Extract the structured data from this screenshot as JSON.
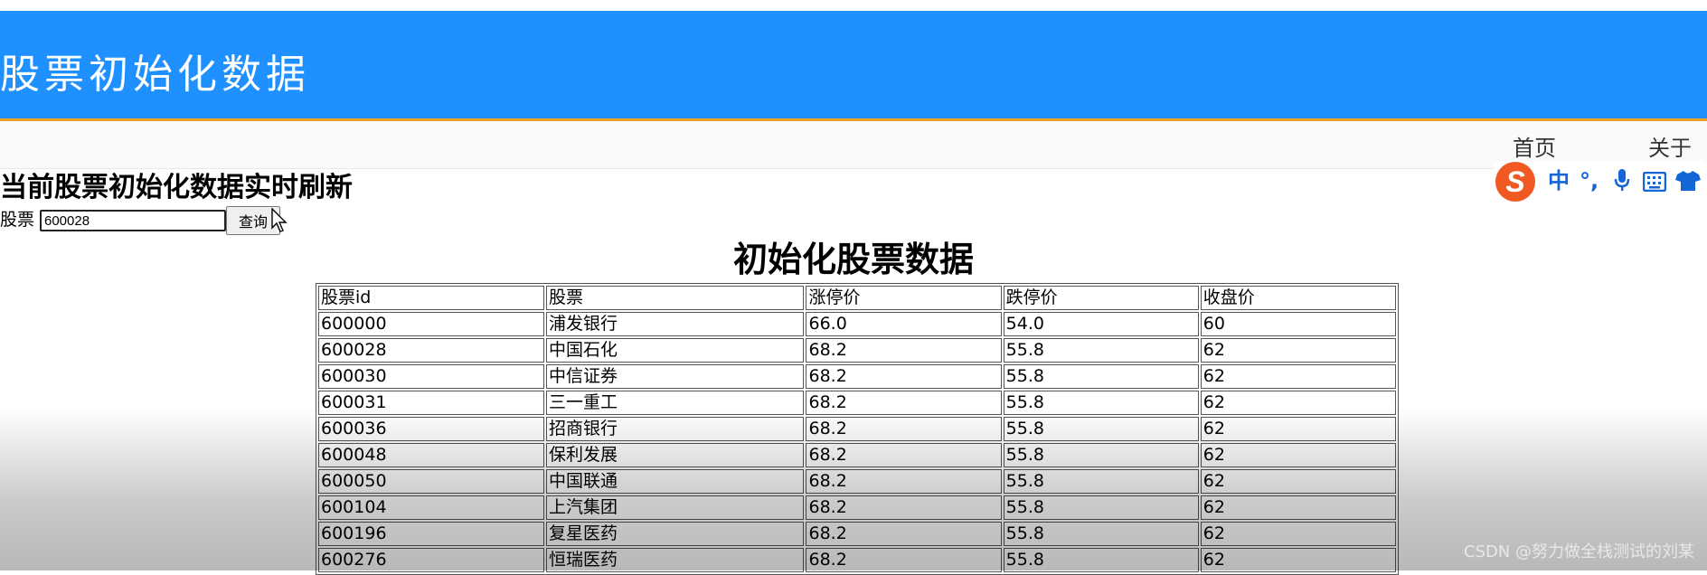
{
  "header": {
    "title": "股票初始化数据"
  },
  "nav": {
    "home": "首页",
    "about": "关于"
  },
  "ime_toolbar": {
    "logo": "S",
    "mode": "中",
    "punct": "°,",
    "mic_icon": "microphone-icon",
    "keyboard_icon": "keyboard-icon",
    "skin_icon": "shirt-icon"
  },
  "main": {
    "heading": "当前股票初始化数据实时刷新",
    "search": {
      "label": "股票",
      "value": "600028",
      "button": "查询"
    },
    "table_title": "初始化股票数据"
  },
  "table": {
    "headers": [
      "股票id",
      "股票",
      "涨停价",
      "跌停价",
      "收盘价"
    ],
    "rows": [
      [
        "600000",
        "浦发银行",
        "66.0",
        "54.0",
        "60"
      ],
      [
        "600028",
        "中国石化",
        "68.2",
        "55.8",
        "62"
      ],
      [
        "600030",
        "中信证券",
        "68.2",
        "55.8",
        "62"
      ],
      [
        "600031",
        "三一重工",
        "68.2",
        "55.8",
        "62"
      ],
      [
        "600036",
        "招商银行",
        "68.2",
        "55.8",
        "62"
      ],
      [
        "600048",
        "保利发展",
        "68.2",
        "55.8",
        "62"
      ],
      [
        "600050",
        "中国联通",
        "68.2",
        "55.8",
        "62"
      ],
      [
        "600104",
        "上汽集团",
        "68.2",
        "55.8",
        "62"
      ],
      [
        "600196",
        "复星医药",
        "68.2",
        "55.8",
        "62"
      ],
      [
        "600276",
        "恒瑞医药",
        "68.2",
        "55.8",
        "62"
      ]
    ]
  },
  "watermark": "CSDN @努力做全栈测试的刘某"
}
